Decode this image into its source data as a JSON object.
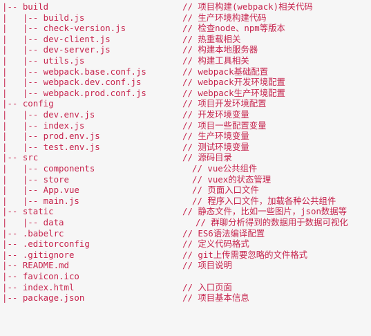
{
  "rows": [
    {
      "path": "|-- build",
      "comment": "// 项目构建(webpack)相关代码"
    },
    {
      "path": "|   |-- build.js",
      "comment": "// 生产环境构建代码"
    },
    {
      "path": "|   |-- check-version.js",
      "comment": "// 检查node、npm等版本"
    },
    {
      "path": "|   |-- dev-client.js",
      "comment": "// 热重载相关"
    },
    {
      "path": "|   |-- dev-server.js",
      "comment": "// 构建本地服务器"
    },
    {
      "path": "|   |-- utils.js",
      "comment": "// 构建工具相关"
    },
    {
      "path": "|   |-- webpack.base.conf.js",
      "comment": "// webpack基础配置"
    },
    {
      "path": "|   |-- webpack.dev.conf.js",
      "comment": "// webpack开发环境配置"
    },
    {
      "path": "|   |-- webpack.prod.conf.js",
      "comment": "// webpack生产环境配置"
    },
    {
      "path": "|-- config",
      "comment": "// 项目开发环境配置"
    },
    {
      "path": "|   |-- dev.env.js",
      "comment": "// 开发环境变量"
    },
    {
      "path": "|   |-- index.js",
      "comment": "// 项目一些配置变量"
    },
    {
      "path": "|   |-- prod.env.js",
      "comment": "// 生产环境变量"
    },
    {
      "path": "|   |-- test.env.js",
      "comment": "// 测试环境变量"
    },
    {
      "path": "|-- src",
      "comment": "// 源码目录"
    },
    {
      "path": "|   |-- components",
      "comment": "// vue公共组件"
    },
    {
      "path": "|   |-- store",
      "comment": "// vuex的状态管理"
    },
    {
      "path": "|   |-- App.vue",
      "comment": "// 页面入口文件"
    },
    {
      "path": "|   |-- main.js",
      "comment": "// 程序入口文件，加载各种公共组件"
    },
    {
      "path": "|-- static",
      "comment": "// 静态文件，比如一些图片，json数据等"
    },
    {
      "path": "|   |-- data",
      "comment": "// 群聊分析得到的数据用于数据可视化"
    },
    {
      "path": "|-- .babelrc",
      "comment": "// ES6语法编译配置"
    },
    {
      "path": "|-- .editorconfig",
      "comment": "// 定义代码格式"
    },
    {
      "path": "|-- .gitignore",
      "comment": "// git上传需要忽略的文件格式"
    },
    {
      "path": "|-- README.md",
      "comment": "// 项目说明"
    },
    {
      "path": "|-- favicon.ico",
      "comment": ""
    },
    {
      "path": "|-- index.html",
      "comment": "// 入口页面"
    },
    {
      "path": "|-- package.json",
      "comment": "// 项目基本信息"
    }
  ]
}
